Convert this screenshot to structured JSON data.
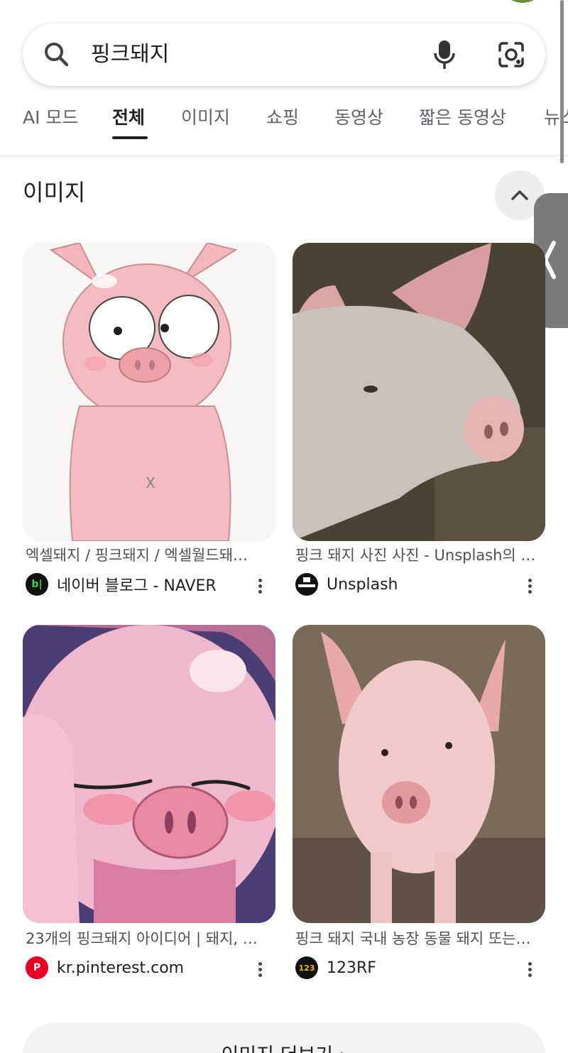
{
  "search": {
    "query": "핑크돼지"
  },
  "tabs": [
    {
      "label": "AI 모드"
    },
    {
      "label": "전체"
    },
    {
      "label": "이미지"
    },
    {
      "label": "쇼핑"
    },
    {
      "label": "동영상"
    },
    {
      "label": "짧은 동영상"
    },
    {
      "label": "뉴스"
    }
  ],
  "images_section": {
    "title": "이미지",
    "results": [
      {
        "caption": "엑셀돼지 / 핑크돼지 / 엑셀월드돼…",
        "source": "네이버 블로그 - NAVER",
        "logo_text": "b|",
        "logo_color": "#111111"
      },
      {
        "caption": "핑크 돼지 사진 사진 - Unsplash의 …",
        "source": "Unsplash",
        "logo_text": "",
        "logo_color": "#111111"
      },
      {
        "caption": "23개의 핑크돼지 아이디어 | 돼지, …",
        "source": "kr.pinterest.com",
        "logo_text": "P",
        "logo_color": "#e60023"
      },
      {
        "caption": "핑크 돼지 국내 농장 동물 돼지 또는…",
        "source": "123RF",
        "logo_text": "123",
        "logo_color": "#111111"
      }
    ],
    "more_button": "이미지 더보기"
  }
}
